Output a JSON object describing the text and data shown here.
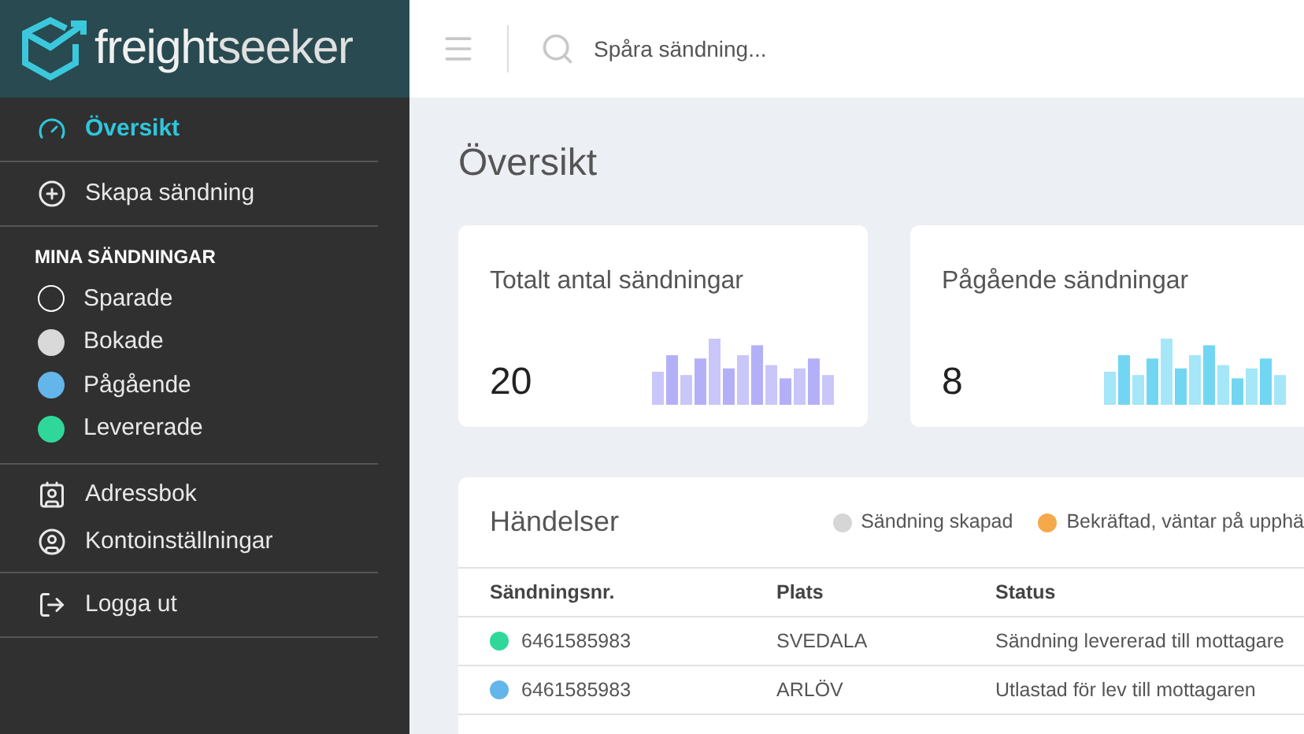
{
  "brand": {
    "name_bold": "freight",
    "name_light": "seeker"
  },
  "sidebar": {
    "nav": [
      {
        "label": "Översikt",
        "kind": "dashboard",
        "selected": true
      },
      {
        "label": "Skapa sändning",
        "kind": "plus",
        "selected": false
      }
    ],
    "section_title": "MINA SÄNDNINGAR",
    "statuses": [
      {
        "label": "Sparade",
        "kind": "outline",
        "color": "#ffffff"
      },
      {
        "label": "Bokade",
        "kind": "filled",
        "color": "#d9d9d9"
      },
      {
        "label": "Pågående",
        "kind": "filled",
        "color": "#63b5ea"
      },
      {
        "label": "Levererade",
        "kind": "filled",
        "color": "#2fd89a"
      }
    ],
    "account": [
      {
        "label": "Adressbok",
        "kind": "contacts"
      },
      {
        "label": "Kontoinställningar",
        "kind": "user"
      }
    ],
    "logout": {
      "label": "Logga ut"
    }
  },
  "topbar": {
    "search": {
      "placeholder": "Spåra sändning..."
    }
  },
  "page_title": "Översikt",
  "stat_cards": [
    {
      "title": "Totalt antal sändningar",
      "value": "20",
      "kind": "purple"
    },
    {
      "title": "Pågående sändningar",
      "value": "8",
      "kind": "cyan"
    }
  ],
  "events": {
    "title": "Händelser",
    "legend": [
      {
        "label": "Sändning skapad",
        "color": "#d6d6d6"
      },
      {
        "label": "Bekräftad, väntar på upphä",
        "color": "#f5a94a"
      }
    ],
    "columns": [
      "Sändningsnr.",
      "Plats",
      "Status"
    ],
    "rows": [
      {
        "number": "6461585983",
        "place": "SVEDALA",
        "status": "Sändning levererad till mottagare",
        "color": "#2fd89a"
      },
      {
        "number": "6461585983",
        "place": "ARLÖV",
        "status": "Utlastad för lev till mottagaren",
        "color": "#63b5ea"
      }
    ]
  }
}
